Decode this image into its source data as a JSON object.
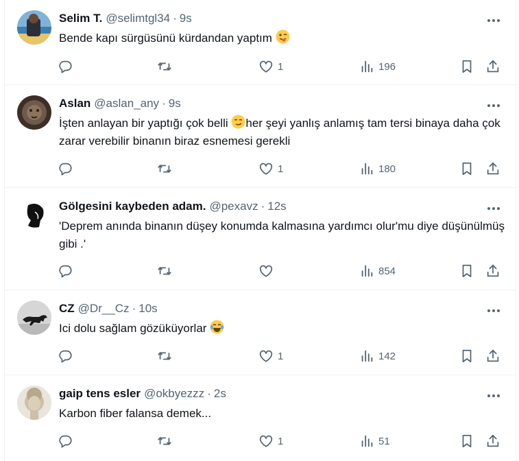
{
  "tweets": [
    {
      "name": "Selim T.",
      "handle": "@selimtgl34",
      "time": "9s",
      "text": "Bende kapı sürgüsünü kürdandan yaptım",
      "text_emoji": "winking-face-with-tongue",
      "likes": "1",
      "views": "196",
      "avatar": "beach-photo"
    },
    {
      "name": "Aslan",
      "handle": "@aslan_any",
      "time": "9s",
      "text_before_emoji": "İşten anlayan bir yaptığı çok belli ",
      "inline_emoji": "smirking-face",
      "text_after_emoji": "her şeyi yanlış anlamış tam tersi binaya daha çok zarar verebilir binanın biraz esnemesi gerekli",
      "likes": "1",
      "views": "180",
      "avatar": "lion-photo"
    },
    {
      "name": "Gölgesini kaybeden adam.",
      "handle": "@pexavz",
      "time": "12s",
      "text": "'Deprem anında binanın düşey konumda kalmasına yardımcı olur'mu diye düşünülmüş gibi .'",
      "likes": "",
      "views": "854",
      "avatar": "silhouette-drawing"
    },
    {
      "name": "CZ",
      "handle": "@Dr__Cz",
      "time": "10s",
      "text": "Ici dolu sağlam gözüküyorlar",
      "text_emoji": "face-with-tears-of-joy",
      "likes": "1",
      "views": "142",
      "avatar": "running-dog-photo"
    },
    {
      "name": "gaip tens esler",
      "handle": "@okbyezzz",
      "time": "2s",
      "text": "Karbon fiber falansa demek...",
      "likes": "1",
      "views": "51",
      "avatar": "statue-photo"
    }
  ],
  "separator": "·",
  "colors": {
    "text_primary": "#0f1419",
    "text_secondary": "#536471",
    "border": "#eff3f4",
    "background": "#ffffff"
  },
  "icons": [
    "reply-icon",
    "retweet-icon",
    "like-icon",
    "views-icon",
    "bookmark-icon",
    "share-icon",
    "more-icon"
  ]
}
